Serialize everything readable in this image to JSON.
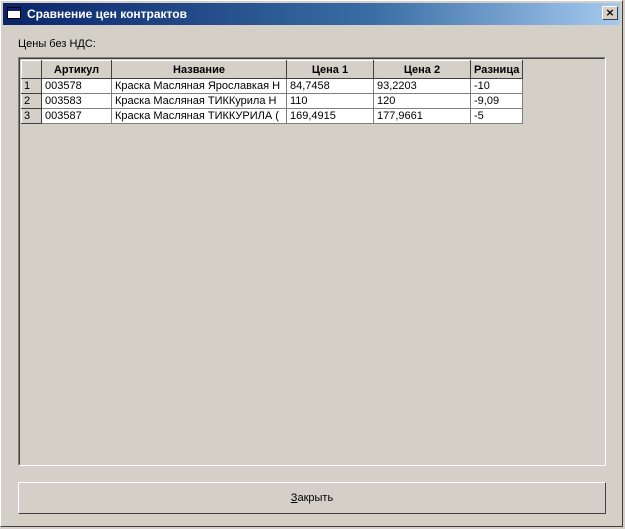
{
  "window": {
    "title": "Сравнение цен контрактов",
    "close_glyph": "×"
  },
  "label_nds": "Цены без НДС:",
  "table": {
    "columns": [
      "Артикул",
      "Название",
      "Цена 1",
      "Цена 2",
      "Разница"
    ],
    "rows": [
      {
        "num": "1",
        "article": "003578",
        "name": "Краска Масляная Ярославкая Н",
        "price1": "84,7458",
        "price2": "93,2203",
        "diff": "-10"
      },
      {
        "num": "2",
        "article": "003583",
        "name": "Краска Масляная ТИККурила Н",
        "price1": "110",
        "price2": "120",
        "diff": "-9,09"
      },
      {
        "num": "3",
        "article": "003587",
        "name": "Краска Масляная ТИККУРИЛА (",
        "price1": "169,4915",
        "price2": "177,9661",
        "diff": "-5"
      }
    ]
  },
  "close_button": {
    "mnemonic": "З",
    "rest": "акрыть"
  },
  "colors": {
    "face": "#d4d0c8",
    "title_start": "#0a246a",
    "title_end": "#a6caf0",
    "cell_bg": "#ffffff"
  }
}
